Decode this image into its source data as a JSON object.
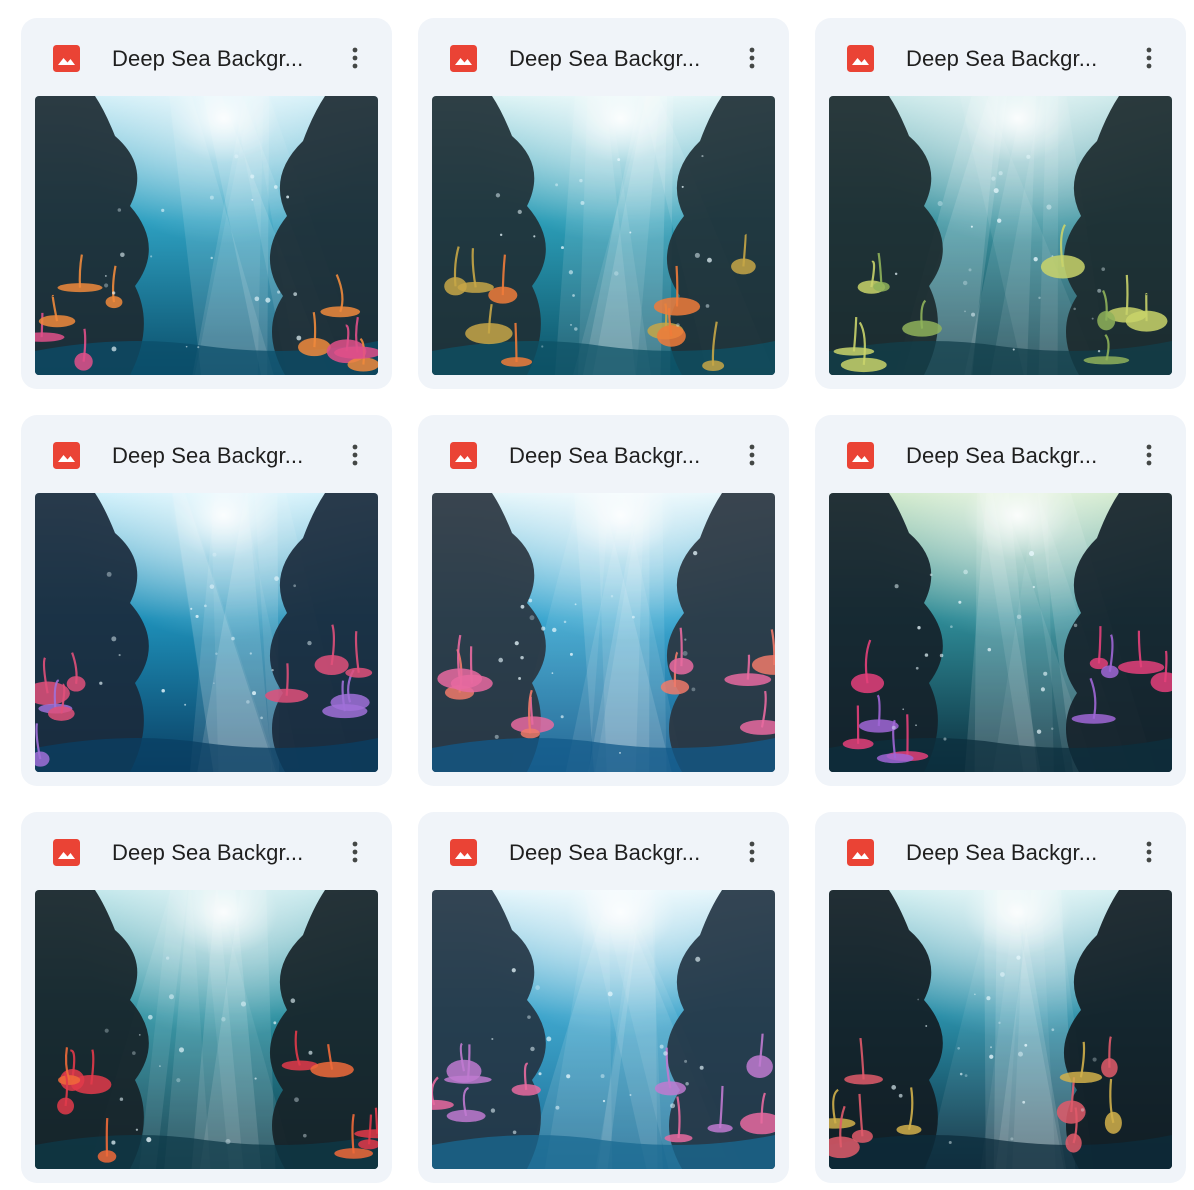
{
  "files": [
    {
      "name": "Deep Sea Background",
      "display_name": "Deep Sea Backgr...",
      "icon": "image-file-icon",
      "more_label": "More actions",
      "palette": {
        "top": "#cfeef7",
        "mid": "#2d9fc0",
        "bottom": "#0b4e6a",
        "rock": "#1d2b33",
        "coral1": "#e0508a",
        "coral2": "#f08a3c"
      }
    },
    {
      "name": "Deep Sea Background",
      "display_name": "Deep Sea Backgr...",
      "icon": "image-file-icon",
      "more_label": "More actions",
      "palette": {
        "top": "#d9f2f4",
        "mid": "#2b9cb6",
        "bottom": "#0d5266",
        "rock": "#203036",
        "coral1": "#f07b3a",
        "coral2": "#c7a646"
      }
    },
    {
      "name": "Deep Sea Background",
      "display_name": "Deep Sea Backgr...",
      "icon": "image-file-icon",
      "more_label": "More actions",
      "palette": {
        "top": "#c6e7e8",
        "mid": "#3b93a0",
        "bottom": "#123f4b",
        "rock": "#1c2a2e",
        "coral1": "#8fb25a",
        "coral2": "#c9d36a"
      }
    },
    {
      "name": "Deep Sea Background",
      "display_name": "Deep Sea Backgr...",
      "icon": "image-file-icon",
      "more_label": "More actions",
      "palette": {
        "top": "#cdf0fb",
        "mid": "#1e8fb8",
        "bottom": "#0a3f63",
        "rock": "#1a2a3c",
        "coral1": "#a070d8",
        "coral2": "#e0507a"
      }
    },
    {
      "name": "Deep Sea Background",
      "display_name": "Deep Sea Backgr...",
      "icon": "image-file-icon",
      "more_label": "More actions",
      "palette": {
        "top": "#e4f6fb",
        "mid": "#3aa6cf",
        "bottom": "#12598a",
        "rock": "#2a3540",
        "coral1": "#f07a6a",
        "coral2": "#e86aa0"
      }
    },
    {
      "name": "Deep Sea Background",
      "display_name": "Deep Sea Backgr...",
      "icon": "image-file-icon",
      "more_label": "More actions",
      "palette": {
        "top": "#cfe9c8",
        "mid": "#2e8a96",
        "bottom": "#0c2f3e",
        "rock": "#15222a",
        "coral1": "#a066d6",
        "coral2": "#e4407a"
      }
    },
    {
      "name": "Deep Sea Background",
      "display_name": "Deep Sea Backgr...",
      "icon": "image-file-icon",
      "more_label": "More actions",
      "palette": {
        "top": "#bfe6ea",
        "mid": "#2a8fa0",
        "bottom": "#0e3a48",
        "rock": "#172328",
        "coral1": "#f06a3a",
        "coral2": "#e23a4a"
      }
    },
    {
      "name": "Deep Sea Background",
      "display_name": "Deep Sea Backgr...",
      "icon": "image-file-icon",
      "more_label": "More actions",
      "palette": {
        "top": "#e2f5fb",
        "mid": "#3ea5cc",
        "bottom": "#1a6a92",
        "rock": "#243544",
        "coral1": "#e86aa0",
        "coral2": "#c07ad0"
      }
    },
    {
      "name": "Deep Sea Background",
      "display_name": "Deep Sea Backgr...",
      "icon": "image-file-icon",
      "more_label": "More actions",
      "palette": {
        "top": "#cfeef0",
        "mid": "#2a8ea8",
        "bottom": "#0c2c3c",
        "rock": "#121d24",
        "coral1": "#d2b04a",
        "coral2": "#e05a6a"
      }
    }
  ],
  "colors": {
    "card_bg": "#f0f4f9",
    "title_text": "#1f1f1f",
    "image_icon_red": "#ea4335",
    "kebab": "#444746"
  }
}
